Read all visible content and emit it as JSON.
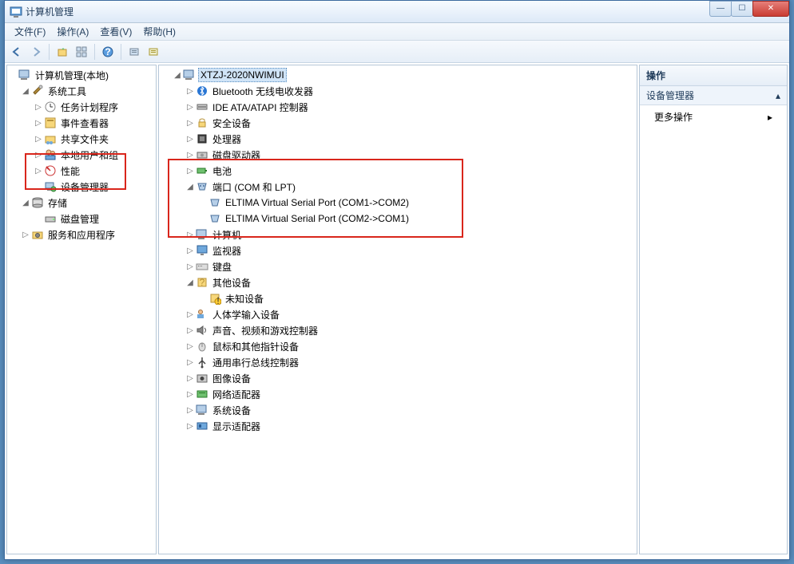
{
  "window": {
    "title": "计算机管理"
  },
  "menu": {
    "file": "文件(F)",
    "action": "操作(A)",
    "view": "查看(V)",
    "help": "帮助(H)"
  },
  "left_tree": {
    "root": "计算机管理(本地)",
    "sys_tools": "系统工具",
    "task_scheduler": "任务计划程序",
    "event_viewer": "事件查看器",
    "shared_folders": "共享文件夹",
    "local_users": "本地用户和组",
    "performance": "性能",
    "device_manager": "设备管理器",
    "storage": "存储",
    "disk_mgmt": "磁盘管理",
    "services_apps": "服务和应用程序"
  },
  "center_tree": {
    "root": "XTZJ-2020NWIMUI",
    "bluetooth": "Bluetooth 无线电收发器",
    "ide": "IDE ATA/ATAPI 控制器",
    "security": "安全设备",
    "cpu": "处理器",
    "disk_drives": "磁盘驱动器",
    "battery": "电池",
    "ports": "端口 (COM 和 LPT)",
    "port1": "ELTIMA Virtual Serial Port (COM1->COM2)",
    "port2": "ELTIMA Virtual Serial Port (COM2->COM1)",
    "computer": "计算机",
    "monitor": "监视器",
    "keyboard": "键盘",
    "other": "其他设备",
    "unknown": "未知设备",
    "hid": "人体学输入设备",
    "sound": "声音、视频和游戏控制器",
    "mouse": "鼠标和其他指针设备",
    "usb": "通用串行总线控制器",
    "imaging": "图像设备",
    "network": "网络适配器",
    "system": "系统设备",
    "display": "显示适配器"
  },
  "right_panel": {
    "header": "操作",
    "section": "设备管理器",
    "more": "更多操作"
  }
}
